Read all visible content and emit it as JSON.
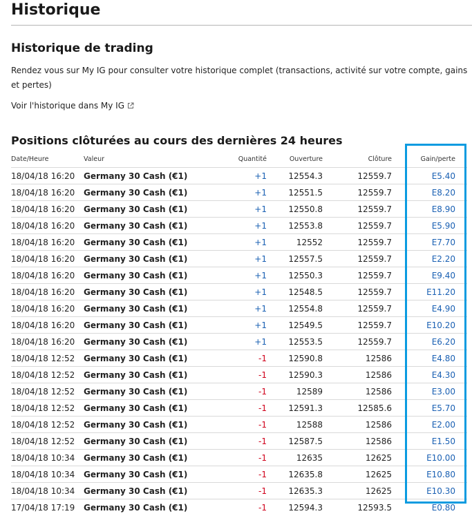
{
  "page": {
    "title": "Historique"
  },
  "trading": {
    "title": "Historique de trading",
    "description": "Rendez vous sur My IG pour consulter votre historique complet (transactions, activité sur votre compte, gains et pertes)",
    "link_label": "Voir l'historique dans My IG",
    "link_icon": "external-link-icon"
  },
  "positions": {
    "title": "Positions clôturées au cours des dernières 24 heures",
    "columns": {
      "date": "Date/Heure",
      "market": "Valeur",
      "quantity": "Quantité",
      "open": "Ouverture",
      "close": "Clôture",
      "pl": "Gain/perte"
    },
    "rows": [
      {
        "date": "18/04/18 16:20",
        "market": "Germany 30 Cash (€1)",
        "quantity": "+1",
        "open": "12554.3",
        "close": "12559.7",
        "pl": "E5.40"
      },
      {
        "date": "18/04/18 16:20",
        "market": "Germany 30 Cash (€1)",
        "quantity": "+1",
        "open": "12551.5",
        "close": "12559.7",
        "pl": "E8.20"
      },
      {
        "date": "18/04/18 16:20",
        "market": "Germany 30 Cash (€1)",
        "quantity": "+1",
        "open": "12550.8",
        "close": "12559.7",
        "pl": "E8.90"
      },
      {
        "date": "18/04/18 16:20",
        "market": "Germany 30 Cash (€1)",
        "quantity": "+1",
        "open": "12553.8",
        "close": "12559.7",
        "pl": "E5.90"
      },
      {
        "date": "18/04/18 16:20",
        "market": "Germany 30 Cash (€1)",
        "quantity": "+1",
        "open": "12552",
        "close": "12559.7",
        "pl": "E7.70"
      },
      {
        "date": "18/04/18 16:20",
        "market": "Germany 30 Cash (€1)",
        "quantity": "+1",
        "open": "12557.5",
        "close": "12559.7",
        "pl": "E2.20"
      },
      {
        "date": "18/04/18 16:20",
        "market": "Germany 30 Cash (€1)",
        "quantity": "+1",
        "open": "12550.3",
        "close": "12559.7",
        "pl": "E9.40"
      },
      {
        "date": "18/04/18 16:20",
        "market": "Germany 30 Cash (€1)",
        "quantity": "+1",
        "open": "12548.5",
        "close": "12559.7",
        "pl": "E11.20"
      },
      {
        "date": "18/04/18 16:20",
        "market": "Germany 30 Cash (€1)",
        "quantity": "+1",
        "open": "12554.8",
        "close": "12559.7",
        "pl": "E4.90"
      },
      {
        "date": "18/04/18 16:20",
        "market": "Germany 30 Cash (€1)",
        "quantity": "+1",
        "open": "12549.5",
        "close": "12559.7",
        "pl": "E10.20"
      },
      {
        "date": "18/04/18 16:20",
        "market": "Germany 30 Cash (€1)",
        "quantity": "+1",
        "open": "12553.5",
        "close": "12559.7",
        "pl": "E6.20"
      },
      {
        "date": "18/04/18 12:52",
        "market": "Germany 30 Cash (€1)",
        "quantity": "-1",
        "open": "12590.8",
        "close": "12586",
        "pl": "E4.80"
      },
      {
        "date": "18/04/18 12:52",
        "market": "Germany 30 Cash (€1)",
        "quantity": "-1",
        "open": "12590.3",
        "close": "12586",
        "pl": "E4.30"
      },
      {
        "date": "18/04/18 12:52",
        "market": "Germany 30 Cash (€1)",
        "quantity": "-1",
        "open": "12589",
        "close": "12586",
        "pl": "E3.00"
      },
      {
        "date": "18/04/18 12:52",
        "market": "Germany 30 Cash (€1)",
        "quantity": "-1",
        "open": "12591.3",
        "close": "12585.6",
        "pl": "E5.70"
      },
      {
        "date": "18/04/18 12:52",
        "market": "Germany 30 Cash (€1)",
        "quantity": "-1",
        "open": "12588",
        "close": "12586",
        "pl": "E2.00"
      },
      {
        "date": "18/04/18 12:52",
        "market": "Germany 30 Cash (€1)",
        "quantity": "-1",
        "open": "12587.5",
        "close": "12586",
        "pl": "E1.50"
      },
      {
        "date": "18/04/18 10:34",
        "market": "Germany 30 Cash (€1)",
        "quantity": "-1",
        "open": "12635",
        "close": "12625",
        "pl": "E10.00"
      },
      {
        "date": "18/04/18 10:34",
        "market": "Germany 30 Cash (€1)",
        "quantity": "-1",
        "open": "12635.8",
        "close": "12625",
        "pl": "E10.80"
      },
      {
        "date": "18/04/18 10:34",
        "market": "Germany 30 Cash (€1)",
        "quantity": "-1",
        "open": "12635.3",
        "close": "12625",
        "pl": "E10.30"
      },
      {
        "date": "17/04/18 17:19",
        "market": "Germany 30 Cash (€1)",
        "quantity": "-1",
        "open": "12594.3",
        "close": "12593.5",
        "pl": "E0.80"
      }
    ]
  },
  "colors": {
    "positive_quantity": "#1a60b3",
    "negative_quantity": "#d0021b",
    "profit_loss": "#1a60b3",
    "highlight_border": "#0a9be0"
  }
}
